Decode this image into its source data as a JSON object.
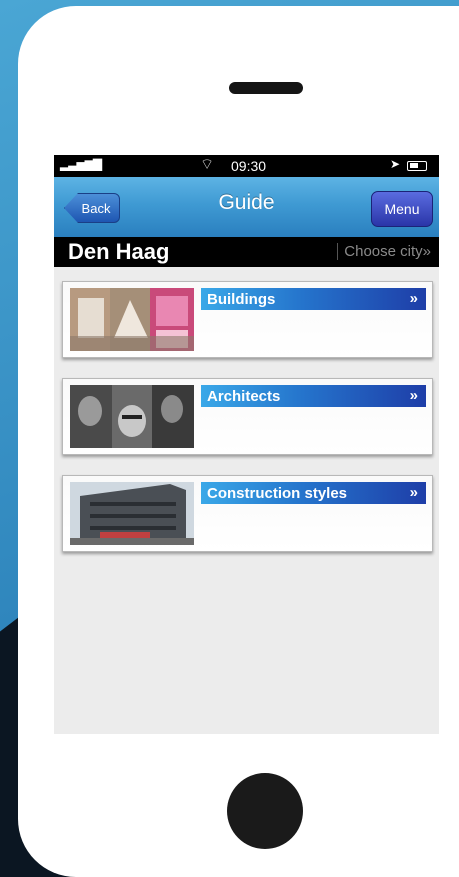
{
  "status_bar": {
    "time": "09:30",
    "signal": "▂▃▅▆▇",
    "wifi": "⌔",
    "location": "➤"
  },
  "nav": {
    "back_label": "Back",
    "title": "Guide",
    "menu_label": "Menu"
  },
  "city_bar": {
    "city": "Den Haag",
    "choose_city": "Choose city»"
  },
  "items": [
    {
      "label": "Buildings",
      "chevron": "»"
    },
    {
      "label": "Architects",
      "chevron": "»"
    },
    {
      "label": "Construction styles",
      "chevron": "»"
    }
  ]
}
